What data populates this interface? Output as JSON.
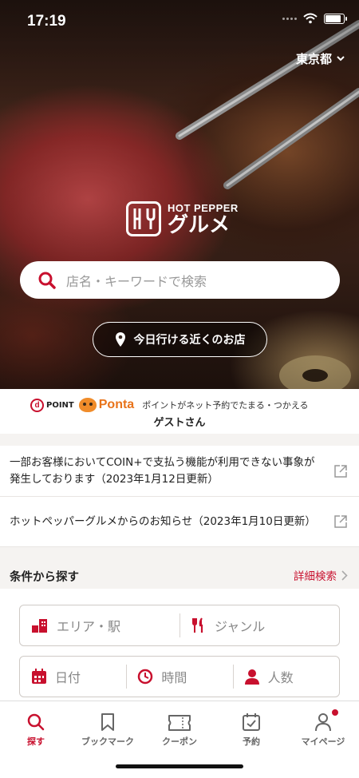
{
  "status_bar": {
    "time": "17:19"
  },
  "hero": {
    "region": "東京都",
    "logo": {
      "top": "HOT PEPPER",
      "main": "グルメ"
    },
    "search": {
      "placeholder": "店名・キーワードで検索"
    },
    "nearby_button": "今日行ける近くのお店"
  },
  "points": {
    "dpoint": "POINT",
    "ponta": "Ponta",
    "description": "ポイントがネット予約でたまる・つかえる",
    "user": "ゲストさん"
  },
  "news": [
    {
      "text": "一部お客様においてCOIN+で支払う機能が利用できない事象が発生しております（2023年1月12日更新）"
    },
    {
      "text": "ホットペッパーグルメからのお知らせ（2023年1月10日更新）"
    }
  ],
  "conditions": {
    "title": "条件から探す",
    "detail": "詳細検索",
    "area": "エリア・駅",
    "genre": "ジャンル",
    "date": "日付",
    "time": "時間",
    "people": "人数"
  },
  "tabs": [
    {
      "label": "探す",
      "icon": "search-icon",
      "active": true
    },
    {
      "label": "ブックマーク",
      "icon": "bookmark-icon"
    },
    {
      "label": "クーポン",
      "icon": "coupon-icon"
    },
    {
      "label": "予約",
      "icon": "calendar-check-icon"
    },
    {
      "label": "マイページ",
      "icon": "person-icon",
      "badge": true
    }
  ],
  "colors": {
    "accent": "#c8102e",
    "background": "#f5f3f1"
  }
}
